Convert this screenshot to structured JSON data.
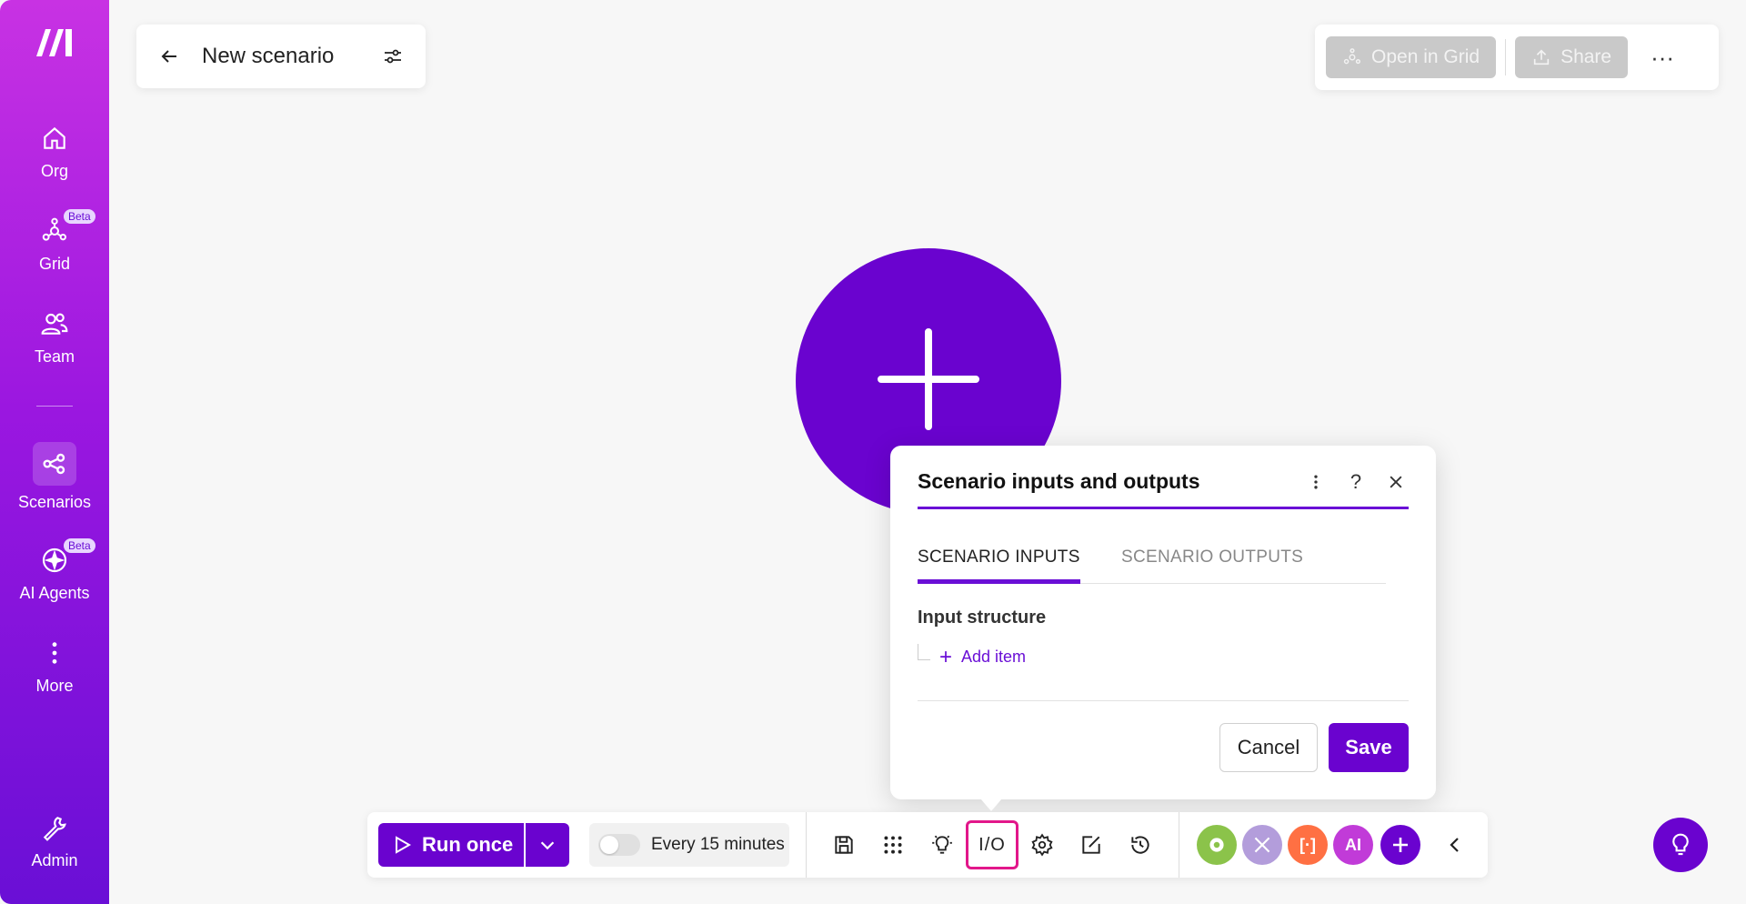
{
  "sidebar": {
    "items": [
      {
        "label": "Org",
        "icon": "home-icon"
      },
      {
        "label": "Grid",
        "icon": "grid-nodes-icon",
        "badge": "Beta"
      },
      {
        "label": "Team",
        "icon": "team-icon"
      },
      {
        "label": "Scenarios",
        "icon": "share-nodes-icon",
        "active": true
      },
      {
        "label": "AI Agents",
        "icon": "sparkle-agent-icon",
        "badge": "Beta"
      },
      {
        "label": "More",
        "icon": "vertical-dots-icon"
      },
      {
        "label": "Admin",
        "icon": "wrench-icon"
      }
    ]
  },
  "header": {
    "title": "New scenario",
    "open_in_grid": "Open in Grid",
    "share": "Share",
    "more": "···"
  },
  "modal": {
    "title": "Scenario inputs and outputs",
    "help": "?",
    "tabs": [
      "SCENARIO INPUTS",
      "SCENARIO OUTPUTS"
    ],
    "section_title": "Input structure",
    "add_item": "Add item",
    "cancel": "Cancel",
    "save": "Save"
  },
  "toolbar": {
    "run_once": "Run once",
    "schedule": "Every 15 minutes",
    "io_label": "I/O",
    "apps": [
      {
        "label": "",
        "color": "#8bc34a",
        "icon": "gear-app-icon"
      },
      {
        "label": "",
        "color": "#b39ddb",
        "icon": "tools-app-icon"
      },
      {
        "label": "[·]",
        "color": "#ff7043",
        "icon": "text-parser-app-icon"
      },
      {
        "label": "AI",
        "color": "#c13bd8",
        "icon": "ai-app-icon"
      }
    ]
  },
  "colors": {
    "brand": "#6a03cf",
    "highlight": "#e2178a"
  }
}
